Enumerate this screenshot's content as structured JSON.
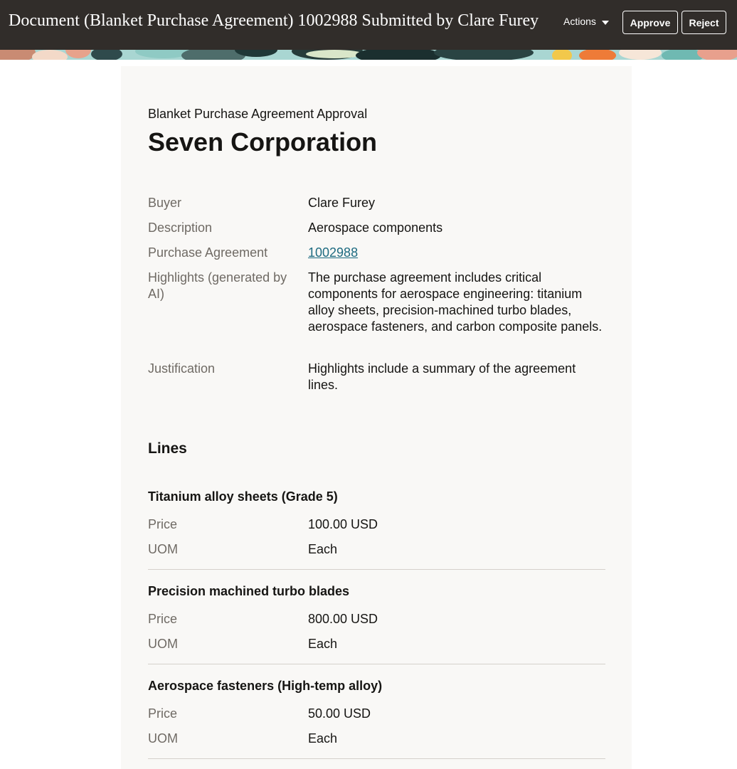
{
  "header": {
    "title": "Document (Blanket Purchase Agreement) 1002988 Submitted by Clare Furey",
    "actions_label": "Actions",
    "approve_label": "Approve",
    "reject_label": "Reject"
  },
  "card": {
    "subtitle": "Blanket Purchase Agreement Approval",
    "supplier": "Seven Corporation",
    "details": [
      {
        "label": "Buyer",
        "value": "Clare Furey"
      },
      {
        "label": "Description",
        "value": "Aerospace components"
      },
      {
        "label": "Purchase Agreement",
        "value": "1002988"
      },
      {
        "label": "Highlights (generated by AI)",
        "value": "The purchase agreement includes critical components for aerospace engineering: titanium alloy sheets, precision-machined turbo blades, aerospace fasteners, and carbon composite panels."
      },
      {
        "label": "Justification",
        "value": "Highlights include a summary of the agreement lines."
      }
    ],
    "lines_title": "Lines",
    "lines": [
      {
        "name": "Titanium alloy sheets (Grade 5)",
        "price_label": "Price",
        "price": "100.00 USD",
        "uom_label": "UOM",
        "uom": "Each"
      },
      {
        "name": "Precision machined turbo blades",
        "price_label": "Price",
        "price": "800.00 USD",
        "uom_label": "UOM",
        "uom": "Each"
      },
      {
        "name": "Aerospace fasteners (High-temp alloy)",
        "price_label": "Price",
        "price": "50.00 USD",
        "uom_label": "UOM",
        "uom": "Each"
      }
    ]
  },
  "colors": {
    "header_bg": "#312d2a",
    "card_bg": "#f9f8f6",
    "link": "#1e6b81",
    "label": "#6f6a64"
  }
}
